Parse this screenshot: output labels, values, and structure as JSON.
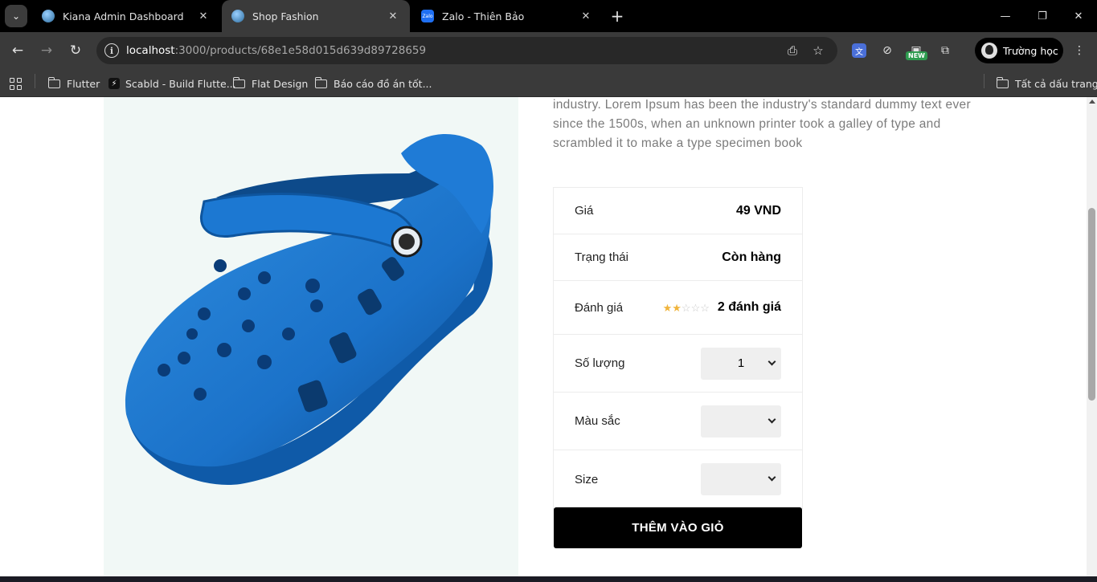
{
  "browser": {
    "tabs": [
      {
        "title": "Kiana Admin Dashboard",
        "active": false
      },
      {
        "title": "Shop Fashion",
        "active": true
      },
      {
        "title": "Zalo - Thiên Bảo",
        "active": false
      }
    ],
    "url_host": "localhost",
    "url_path": ":3000/products/68e1e58d015d639d89728659",
    "ext_badge": "NEW",
    "profile_name": "Trường học",
    "bookmarks": [
      {
        "label": "Flutter",
        "icon": "folder-icon"
      },
      {
        "label": "Scabld - Build Flutte...",
        "icon": "scabld-icon"
      },
      {
        "label": "Flat Design",
        "icon": "folder-icon"
      },
      {
        "label": "Báo cáo đồ án tốt..."
      }
    ],
    "all_bookmarks": "Tất cả dấu trang"
  },
  "product": {
    "description": "industry. Lorem Ipsum has been the industry's standard dummy text ever since the 1500s, when an unknown printer took a galley of type and scrambled it to make a type specimen book",
    "price_label": "Giá",
    "price_value": "49 VND",
    "status_label": "Trạng thái",
    "status_value": "Còn hàng",
    "rating_label": "Đánh giá",
    "rating_stars": 2,
    "rating_max": 5,
    "rating_count": "2 đánh giá",
    "quantity_label": "Số lượng",
    "quantity_value": "1",
    "color_label": "Màu sắc",
    "color_value": "",
    "size_label": "Size",
    "size_value": "",
    "add_to_cart": "THÊM VÀO GIỎ"
  },
  "colors": {
    "shoe_blue": "#1b72c9",
    "star": "#f0b43c",
    "image_bg": "#f1f8f6"
  }
}
